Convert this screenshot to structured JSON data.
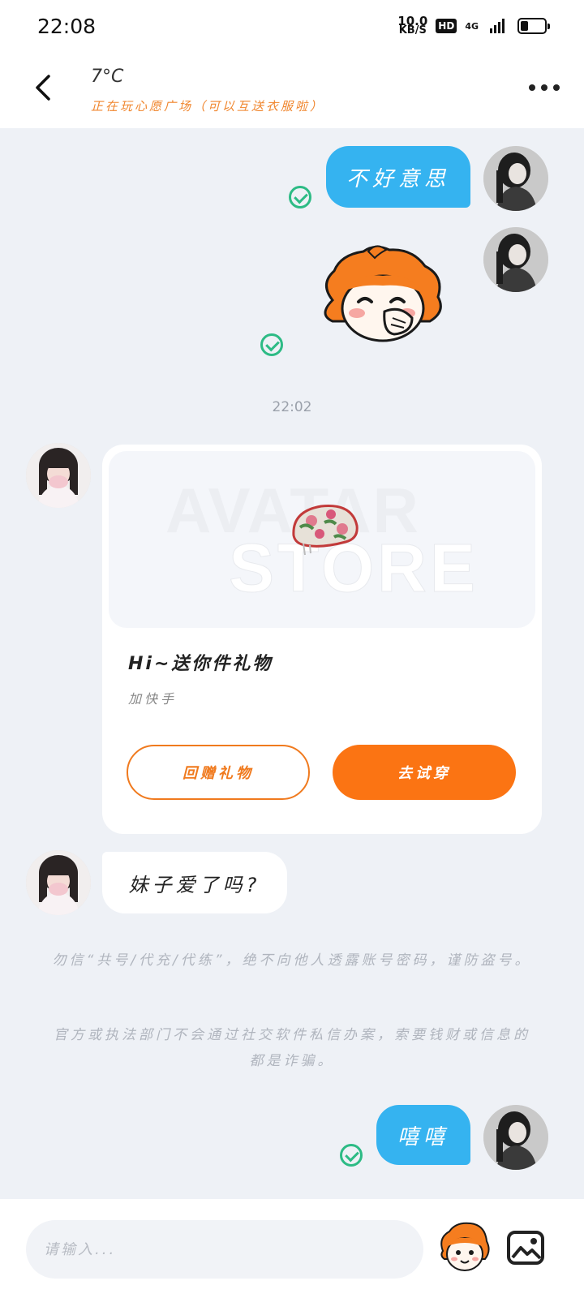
{
  "status_bar": {
    "time": "22:08",
    "net_speed_value": "10.0",
    "net_speed_unit": "KB/S",
    "hd_label": "HD",
    "network_type": "4G"
  },
  "header": {
    "title": "7°C",
    "subtitle": "正在玩心愿广场（可以互送衣服啦）"
  },
  "messages": {
    "me_1_text": "不好意思",
    "timestamp": "22:02",
    "gift_title": "Hi~送你件礼物",
    "gift_source": "加快手",
    "gift_watermark_1": "AVATAR",
    "gift_watermark_2": "STORE",
    "gift_return_label": "回赠礼物",
    "gift_tryon_label": "去试穿",
    "other_text": "妹子爱了吗?",
    "me_2_text": "嘻嘻"
  },
  "notices": {
    "line_1": "勿信“共号/代充/代练”，绝不向他人透露账号密码，谨防盗号。",
    "line_2": "官方或执法部门不会通过社交软件私信办案，索要钱财或信息的都是诈骗。"
  },
  "input": {
    "placeholder": "请输入..."
  },
  "colors": {
    "accent_orange": "#fb7413",
    "bubble_blue": "#35b3f0",
    "check_green": "#2dbb85",
    "subtitle_orange": "#f0862e"
  }
}
